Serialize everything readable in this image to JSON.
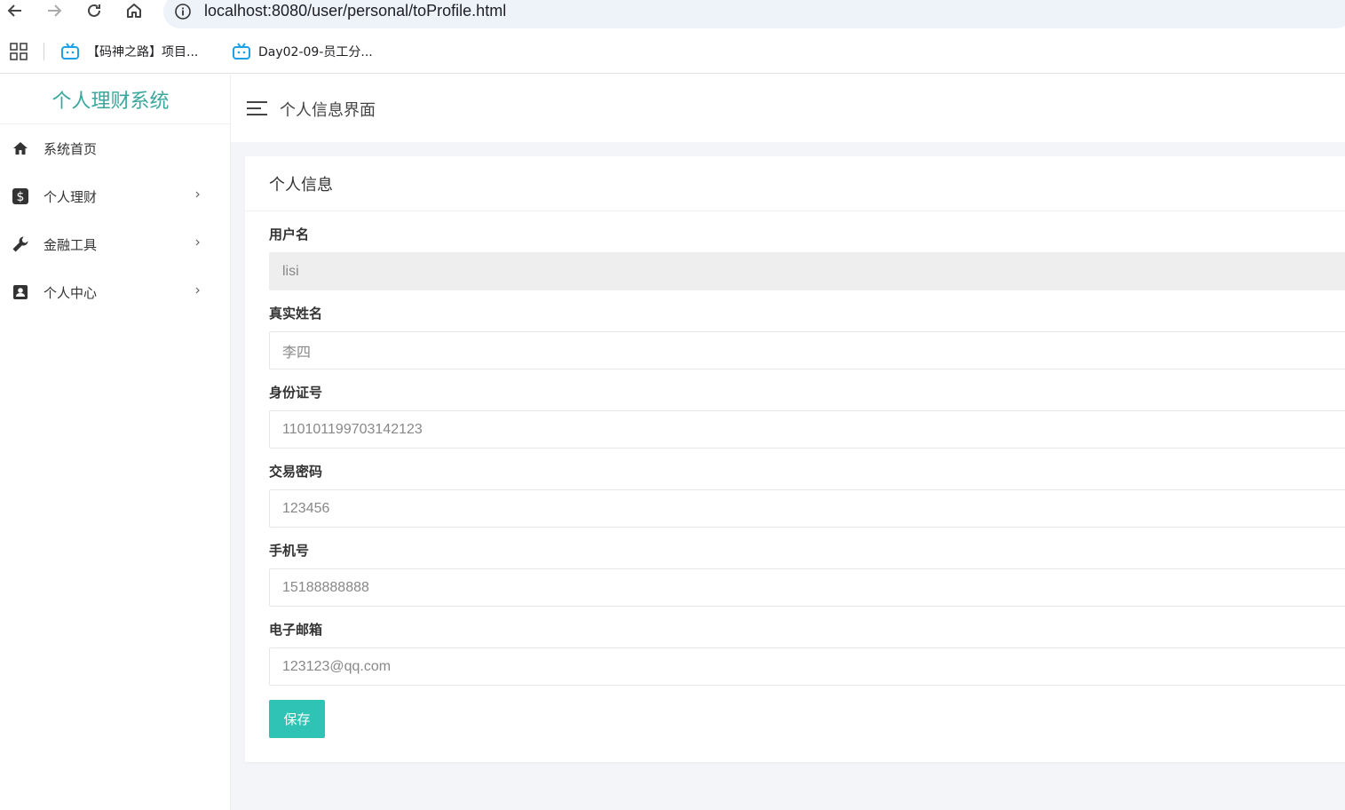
{
  "browser": {
    "url": "localhost:8080/user/personal/toProfile.html",
    "bookmarks": [
      {
        "label": "【码神之路】项目..."
      },
      {
        "label": "Day02-09-员工分..."
      }
    ]
  },
  "sidebar": {
    "brand": "个人理财系统",
    "items": [
      {
        "label": "系统首页",
        "icon": "home-icon",
        "has_children": false
      },
      {
        "label": "个人理财",
        "icon": "dollar-icon",
        "has_children": true
      },
      {
        "label": "金融工具",
        "icon": "wrench-icon",
        "has_children": true
      },
      {
        "label": "个人中心",
        "icon": "contact-icon",
        "has_children": true
      }
    ]
  },
  "header": {
    "title": "个人信息界面"
  },
  "card": {
    "title": "个人信息",
    "fields": {
      "username": {
        "label": "用户名",
        "value": "lisi"
      },
      "realname": {
        "label": "真实姓名",
        "value": "李四"
      },
      "idcard": {
        "label": "身份证号",
        "value": "110101199703142123"
      },
      "paypwd": {
        "label": "交易密码",
        "value": "123456"
      },
      "phone": {
        "label": "手机号",
        "value": "15188888888"
      },
      "email": {
        "label": "电子邮箱",
        "value": "123123@qq.com"
      }
    },
    "save_label": "保存"
  },
  "colors": {
    "accent": "#2ec3b4",
    "brand": "#3aa79c"
  }
}
